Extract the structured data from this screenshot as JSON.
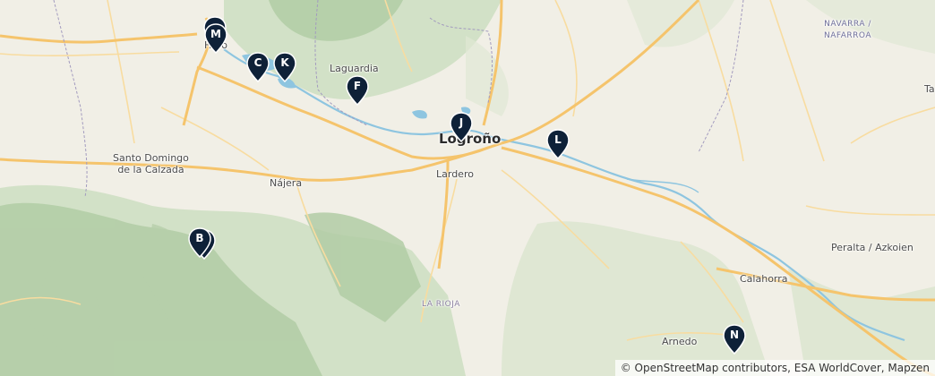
{
  "map": {
    "places": {
      "haro": "Haro",
      "laguardia": "Laguardia",
      "logrono": "Logroño",
      "santo_domingo": "Santo Domingo\nde la Calzada",
      "najera": "Nájera",
      "lardero": "Lardero",
      "navarra": "NAVARRA /\nNAFARROA",
      "peralta": "Peralta / Azkoien",
      "calahorra": "Calahorra",
      "arnedo": "Arnedo",
      "la_rioja": "LA RIOJA",
      "ta": "Ta"
    },
    "markers": [
      {
        "letter": "M"
      },
      {
        "letter": "C"
      },
      {
        "letter": "K"
      },
      {
        "letter": "F"
      },
      {
        "letter": "J"
      },
      {
        "letter": "L"
      },
      {
        "letter": "B"
      },
      {
        "letter": "N"
      }
    ],
    "attribution": "© OpenStreetMap contributors, ESA WorldCover, Mapzen",
    "colors": {
      "marker": "#0e2138",
      "road_major": "#f5c46c",
      "road_minor": "#f8dca0",
      "water": "#8ec5e0",
      "forest": "#b9d3ae",
      "land": "#f1efe6"
    }
  }
}
